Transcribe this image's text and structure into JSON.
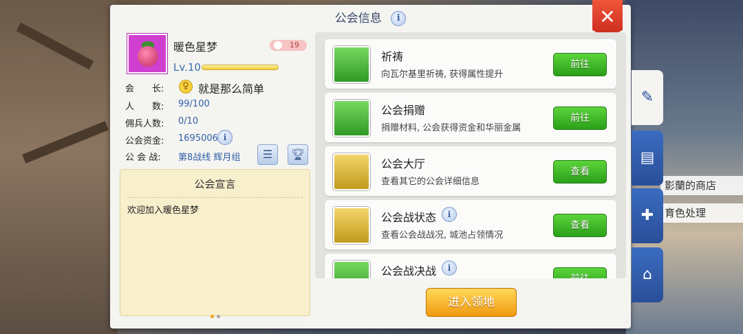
{
  "window": {
    "title": "公会信息"
  },
  "guild": {
    "name": "暖色星梦",
    "badge_count": "19",
    "level": "Lv.10",
    "level_fraction": 1.0,
    "leader_label": "会　　长:",
    "leader_name": "就是那么简单",
    "members_label": "人　　数:",
    "members_value": "99/100",
    "mercenary_label": "佣兵人数:",
    "mercenary_value": "0/10",
    "funds_label": "公会资金:",
    "funds_value": "16950066",
    "war_label": "公 会 战:",
    "war_value": "第8战线  辉月组"
  },
  "manifesto": {
    "title": "公会宣言",
    "text": "欢迎加入暖色星梦"
  },
  "items": [
    {
      "title": "祈祷",
      "desc": "向瓦尔基里祈祷, 获得属性提升",
      "button": "前往"
    },
    {
      "title": "公会捐赠",
      "desc": "捐赠材料, 公会获得资金和华丽金属",
      "button": "前往"
    },
    {
      "title": "公会大厅",
      "desc": "查看其它的公会详细信息",
      "button": "查看"
    },
    {
      "title": "公会战状态",
      "desc": "查看公会战战况, 城池占领情况",
      "button": "查看"
    },
    {
      "title": "公会战决战",
      "desc": "",
      "button": "前往"
    }
  ],
  "enter_button": "进入领地",
  "background": {
    "shop_sign_1": "影蘭的商店",
    "shop_sign_2": "育色处理"
  },
  "icons": {
    "close": "close-icon",
    "info": "info-icon",
    "list": "list-icon",
    "trophy": "trophy-icon",
    "edit": "edit-icon",
    "contacts": "contacts-icon",
    "guild": "guild-icon",
    "house": "house-icon"
  },
  "colors": {
    "accent_blue": "#2f5fa8",
    "button_green": "#2aa01a",
    "button_gold": "#f09a10",
    "close_red": "#d43a2a"
  }
}
